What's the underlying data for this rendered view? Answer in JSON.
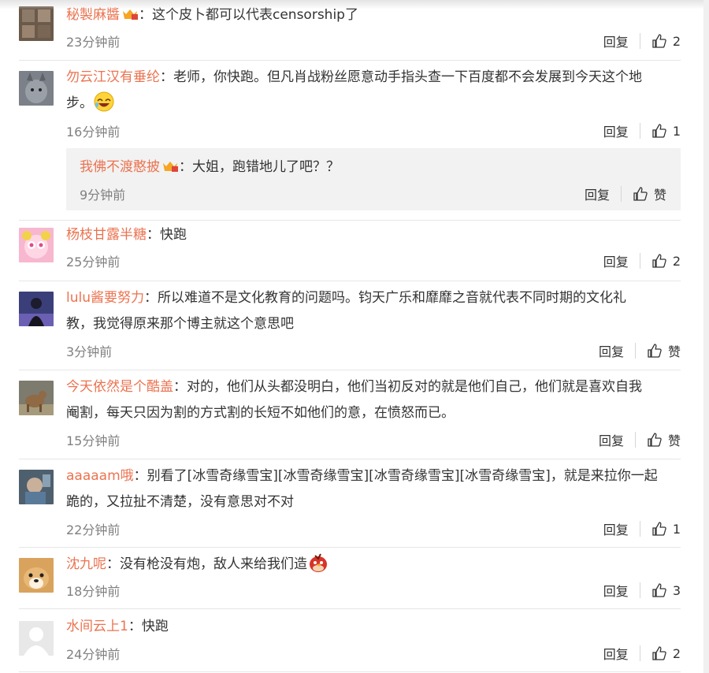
{
  "comments": [
    {
      "user": "秘製麻醬",
      "text": "：这个皮卜都可以代表censorship了",
      "time": "23分钟前",
      "reply": "回复",
      "likes": "2"
    },
    {
      "user": "勿云江汉有垂纶",
      "text": "：老师，你快跑。但凡肖战粉丝愿意动手指头查一下百度都不会发展到今天这个地",
      "text2": "步。",
      "time": "16分钟前",
      "reply": "回复",
      "likes": "1",
      "sub": {
        "user": "我佛不渡憨披",
        "text": "：大姐，跑错地儿了吧？？",
        "time": "9分钟前",
        "reply": "回复",
        "likes": "赞"
      }
    },
    {
      "user": "杨枝甘露半糖",
      "text": "：快跑",
      "time": "25分钟前",
      "reply": "回复",
      "likes": "2"
    },
    {
      "user": "lulu酱要努力",
      "text": "：所以难道不是文化教育的问题吗。钧天广乐和靡靡之音就代表不同时期的文化礼",
      "text2": "教，我觉得原来那个博主就这个意思吧",
      "time": "3分钟前",
      "reply": "回复",
      "likes": "赞"
    },
    {
      "user": "今天依然是个酷盖",
      "text": "：对的，他们从头都没明白，他们当初反对的就是他们自己，他们就是喜欢自我",
      "text2": "阉割，每天只因为割的方式割的长短不如他们的意，在愤怒而已。",
      "time": "15分钟前",
      "reply": "回复",
      "likes": "赞"
    },
    {
      "user": "aaaaam哦",
      "text": "：别看了[冰雪奇缘雪宝][冰雪奇缘雪宝][冰雪奇缘雪宝][冰雪奇缘雪宝]，就是来拉你一起",
      "text2": "跪的，又拉扯不清楚，没有意思对不对",
      "time": "22分钟前",
      "reply": "回复",
      "likes": "1"
    },
    {
      "user": "沈九呢",
      "text": "：没有枪没有炮，敌人来给我们造",
      "time": "18分钟前",
      "reply": "回复",
      "likes": "3"
    },
    {
      "user": "水间云上1",
      "text": "：快跑",
      "time": "24分钟前",
      "reply": "回复",
      "likes": "2"
    }
  ],
  "colors": {
    "username": "#eb7350",
    "text": "#333333",
    "meta": "#808080",
    "divider": "#e6e6e6"
  },
  "icons": {
    "like": "thumbs-up-icon",
    "badge": "vip-crown-badge-icon",
    "emoji_laugh": "laughing-face-emoji",
    "emoji_angry": "angry-bird-emoji"
  }
}
